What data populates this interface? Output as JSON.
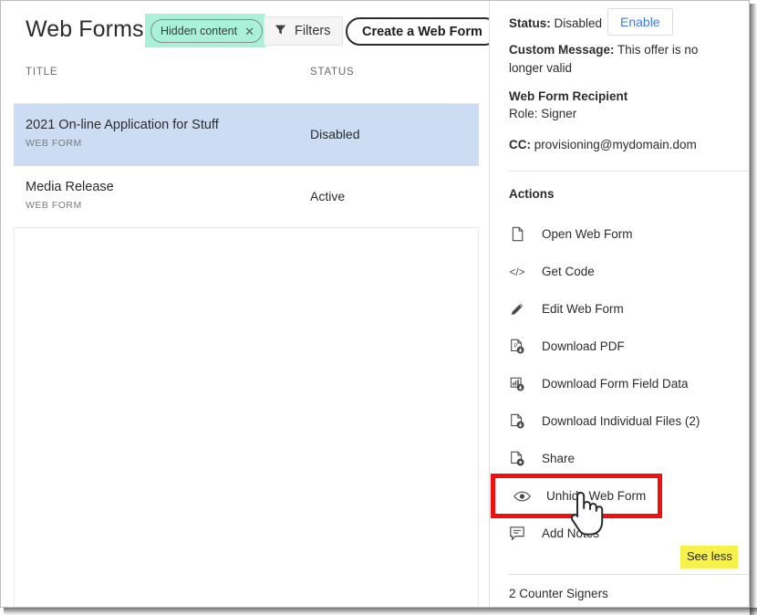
{
  "toolbar": {
    "page_title": "Web Forms",
    "filter_chip": {
      "label": "Hidden content",
      "close_glyph": "✕",
      "highlight_color": "#a9f2d9"
    },
    "filters_button": {
      "label": "Filters",
      "icon": "funnel-icon"
    },
    "create_button": {
      "label": "Create a Web Form"
    }
  },
  "list": {
    "columns": [
      "TITLE",
      "STATUS"
    ],
    "rows": [
      {
        "title": "2021 On-line Application for Stuff",
        "type": "WEB FORM",
        "status": "Disabled",
        "selected": true
      },
      {
        "title": "Media Release",
        "type": "WEB FORM",
        "status": "Active",
        "selected": false
      }
    ],
    "selected_row_color": "#cbdcf3"
  },
  "detail": {
    "status_label": "Status:",
    "status_value": "Disabled",
    "enable_button": "Enable",
    "custom_message_label": "Custom Message:",
    "custom_message_value": "This offer is no longer valid",
    "recipient_heading": "Web Form Recipient",
    "recipient_role": "Role: Signer",
    "cc_label": "CC:",
    "cc_value": "provisioning@mydomain.dom",
    "actions_heading": "Actions",
    "actions": [
      {
        "label": "Open Web Form",
        "icon": "document-icon",
        "highlighted": false
      },
      {
        "label": "Get Code",
        "icon": "code-icon",
        "highlighted": false
      },
      {
        "label": "Edit Web Form",
        "icon": "pencil-icon",
        "highlighted": false
      },
      {
        "label": "Download PDF",
        "icon": "pdf-download-icon",
        "highlighted": false
      },
      {
        "label": "Download Form Field Data",
        "icon": "chart-download-icon",
        "highlighted": false
      },
      {
        "label": "Download Individual Files (2)",
        "icon": "file-download-icon",
        "highlighted": false
      },
      {
        "label": "Share",
        "icon": "file-share-icon",
        "highlighted": false
      },
      {
        "label": "Unhide Web Form",
        "icon": "eye-icon",
        "highlighted": true
      },
      {
        "label": "Add Notes",
        "icon": "comment-icon",
        "highlighted": false
      }
    ],
    "see_less": "See less",
    "see_less_highlight_color": "#f7f14c",
    "counter_signers": "2 Counter Signers",
    "highlight_box_color": "#f01010",
    "enable_link_color": "#3a7ce1"
  }
}
